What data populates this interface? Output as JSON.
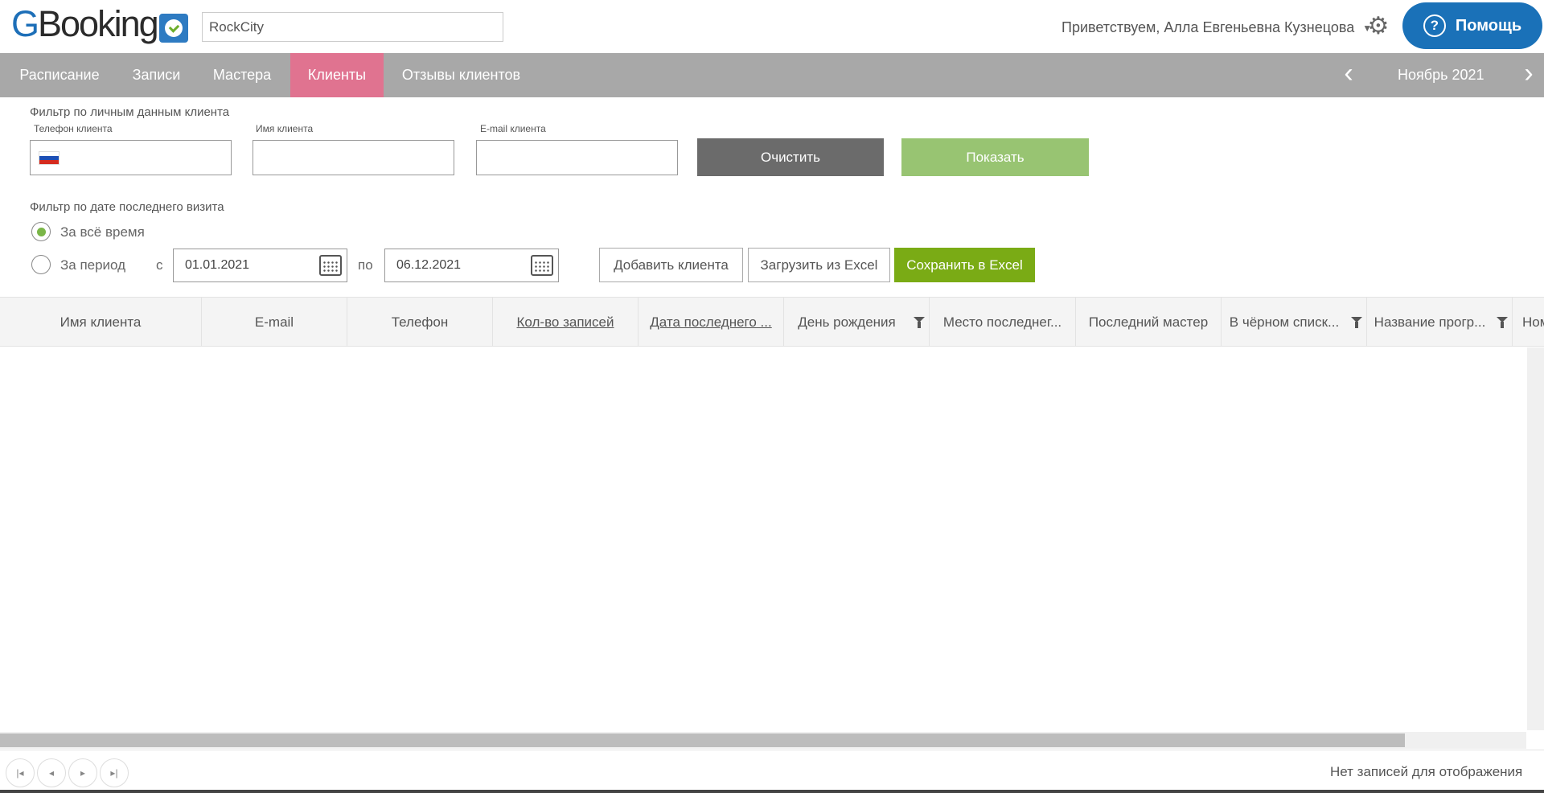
{
  "header": {
    "logo_letter_g": "G",
    "logo_text": "Booking",
    "company_value": "RockCity",
    "greeting": "Приветствуем, Алла Евгеньевна Кузнецова",
    "help_label": "Помощь"
  },
  "nav": {
    "items": [
      "Расписание",
      "Записи",
      "Мастера",
      "Клиенты",
      "Отзывы клиентов"
    ],
    "active": "Клиенты",
    "month": "Ноябрь 2021"
  },
  "filter_personal": {
    "title": "Фильтр по личным данным клиента",
    "phone_label": "Телефон клиента",
    "name_label": "Имя клиента",
    "email_label": "E-mail клиента",
    "phone_value": "",
    "name_value": "",
    "email_value": "",
    "clear_label": "Очистить",
    "show_label": "Показать"
  },
  "filter_date": {
    "title": "Фильтр по дате последнего визита",
    "all_time_label": "За всё время",
    "period_label": "За период",
    "selected": "all_time",
    "from_label": "с",
    "to_label": "по",
    "from_value": "01.01.2021",
    "to_value": "06.12.2021"
  },
  "actions": {
    "add_client": "Добавить клиента",
    "import_excel": "Загрузить из Excel",
    "export_excel": "Сохранить в Excel"
  },
  "grid": {
    "columns": [
      "Имя клиента",
      "E-mail",
      "Телефон",
      "Кол-во записей",
      "Дата последнего ...",
      "День рождения",
      "Место последнег...",
      "Последний мастер",
      "В чёрном списк...",
      "Название прогр...",
      "Ном"
    ],
    "rows": []
  },
  "pager": {
    "empty_text": "Нет записей для отображения"
  },
  "colors": {
    "brand_blue": "#1a71b8",
    "nav_gray": "#a8a8a8",
    "nav_active": "#e07390",
    "clear_button": "#6b6b6b",
    "show_button": "#98c472",
    "save_button": "#7aab15"
  },
  "icons": [
    "logo-clock-icon",
    "caret-down-icon",
    "gear-icon",
    "help-question-icon",
    "chevron-left-icon",
    "chevron-right-icon",
    "russia-flag-icon",
    "calendar-icon",
    "filter-icon",
    "first-page-icon",
    "prev-page-icon",
    "next-page-icon",
    "last-page-icon"
  ]
}
